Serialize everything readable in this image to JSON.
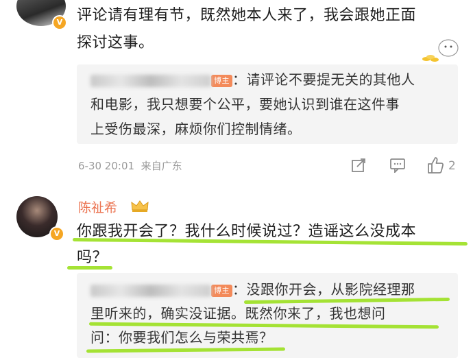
{
  "comment_top": {
    "text_line1": "评论请有理有节，既然她本人来了，我会跟她正面",
    "text_line2": "探讨这事。",
    "reply": {
      "owner_tag": "博主",
      "line1": "：请评论不要提无关的其他人",
      "line2": "和电影，我只想要个公平，要她认识到谁在这件事",
      "line3": "上受伤最深，麻烦你们控制情绪。"
    },
    "meta": {
      "date": "6-30 20:01",
      "location": "来自广东",
      "like_count": "2"
    }
  },
  "comment_chen": {
    "username": "陈祉希",
    "text_line1": "你跟我开会了？我什么时候说过？造谣这么没成本",
    "text_line2": "吗？",
    "reply": {
      "owner_tag": "博主",
      "line1": "：没跟你开会，从影院经理那",
      "line2": "里听来的，确实没证据。既然你来了，我也想问",
      "line3": "问：你要我们怎么与荣共焉？"
    }
  },
  "colors": {
    "username": "#eb7350",
    "highlight": "#9be01f",
    "meta": "#9a9a9a"
  }
}
